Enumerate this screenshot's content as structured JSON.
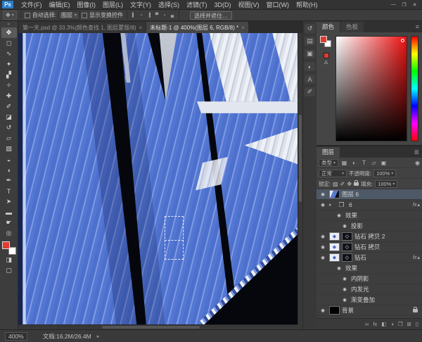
{
  "colors": {
    "blue": "#4c70cc",
    "blue_light": "#8099e3",
    "blue_mid": "#5377d2",
    "blue_deep": "#33509f",
    "ink": "#05070d",
    "paper": "#eef1f7",
    "paper_dim": "#c6ccd9",
    "fg_red": "#e23b30"
  },
  "app": {
    "logo_text": "Ps"
  },
  "window_controls": {
    "minimize": "—",
    "restore": "❐",
    "close": "✕"
  },
  "menu": {
    "items": [
      "文件(F)",
      "编辑(E)",
      "图像(I)",
      "图层(L)",
      "文字(Y)",
      "选择(S)",
      "滤镜(T)",
      "3D(D)",
      "视图(V)",
      "窗口(W)",
      "帮助(H)"
    ]
  },
  "options": {
    "tool_glyph": "✥",
    "auto_select_label": "自动选择:",
    "auto_select_value": "图层",
    "transform_label": "显示变换控件",
    "align_icons": [
      "▌",
      "▪",
      "▐",
      "▀",
      "▪",
      "▄"
    ],
    "select_mask_label": "选择并遮住…"
  },
  "doc_tabs": [
    {
      "title": "第一天.psd @ 33.3%(颜色查找 1, 图层蒙版/8)",
      "close": "×"
    },
    {
      "title": "未标题-1 @ 400%(图层 6, RGB/8) *",
      "close": "×"
    }
  ],
  "toolbar": {
    "collapse": "»",
    "tools": [
      {
        "name": "move",
        "glyph": "✥"
      },
      {
        "name": "marquee",
        "glyph": "◻"
      },
      {
        "name": "lasso",
        "glyph": "∿"
      },
      {
        "name": "quick-selection",
        "glyph": "✦"
      },
      {
        "name": "crop",
        "glyph": "▞"
      },
      {
        "name": "eyedropper",
        "glyph": "✧"
      },
      {
        "name": "healing-brush",
        "glyph": "✚"
      },
      {
        "name": "brush",
        "glyph": "✐"
      },
      {
        "name": "clone-stamp",
        "glyph": "◪"
      },
      {
        "name": "history-brush",
        "glyph": "↺"
      },
      {
        "name": "eraser",
        "glyph": "▱"
      },
      {
        "name": "gradient",
        "glyph": "▨"
      },
      {
        "name": "blur",
        "glyph": "◒"
      },
      {
        "name": "dodge",
        "glyph": "◖"
      },
      {
        "name": "pen",
        "glyph": "✒"
      },
      {
        "name": "type",
        "glyph": "T"
      },
      {
        "name": "path-selection",
        "glyph": "➤"
      },
      {
        "name": "shape",
        "glyph": "▬"
      },
      {
        "name": "hand",
        "glyph": "☛"
      },
      {
        "name": "zoom",
        "glyph": "◎"
      }
    ],
    "quick_mask_glyph": "◨",
    "screen_mode_glyph": "▢"
  },
  "side_strip": {
    "icons": [
      "↺",
      "▤",
      "▣",
      "◐",
      "A",
      "✐"
    ]
  },
  "color_panel": {
    "tabs": [
      "颜色",
      "色板"
    ],
    "menu_glyph": "≡",
    "warning_glyph": "⚠"
  },
  "layers_panel": {
    "tab": "图层",
    "menu_glyph": "≣",
    "filter_label": "类型",
    "filter_icons": [
      "▦",
      "◐",
      "T",
      "▱",
      "▣"
    ],
    "filter_toggle": "◉",
    "blend_mode": "正常",
    "opacity_label": "不透明度:",
    "opacity_value": "100%",
    "lock_label": "锁定:",
    "lock_icons": [
      "▨",
      "✐",
      "✥"
    ],
    "fill_label": "填充:",
    "fill_value": "100%",
    "fx_label": "fx",
    "rows": [
      {
        "name": "图层 6"
      },
      {
        "name": "6"
      },
      {
        "name": "效果"
      },
      {
        "name": "投影"
      },
      {
        "name": "钻石 拷贝 2"
      },
      {
        "name": "钻石 拷贝"
      },
      {
        "name": "钻石"
      },
      {
        "name": "效果"
      },
      {
        "name": "内阴影"
      },
      {
        "name": "内发光"
      },
      {
        "name": "渐变叠加"
      },
      {
        "name": "背景"
      }
    ],
    "bottom_icons": [
      "∞",
      "fx",
      "◧",
      "◑",
      "❐",
      "⊞",
      "▯"
    ]
  },
  "status_bar": {
    "zoom": "400%",
    "doc_info": "文档:16.2M/26.4M",
    "arrow": "▸"
  },
  "icons": {
    "eye": "◉",
    "caret_down": "▾",
    "caret_right": "▸",
    "caret_up": "▴",
    "folder": "❐",
    "diamond": "◆",
    "diamond_outline": "◇"
  }
}
